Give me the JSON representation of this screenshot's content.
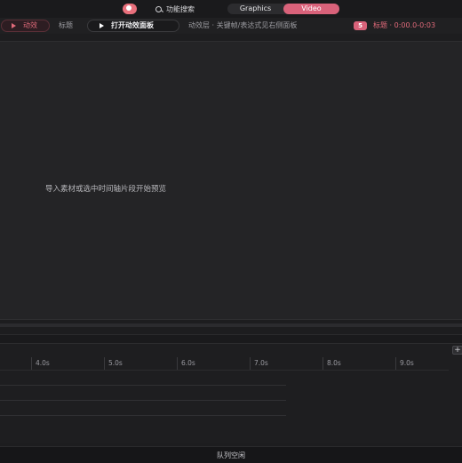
{
  "topbar": {
    "search_label": "功能搜索",
    "mode_tabs": [
      {
        "label": "Graphics",
        "active": false
      },
      {
        "label": "Video",
        "active": true
      }
    ]
  },
  "toolbar": {
    "effect_label": "动效",
    "title_label": "标题",
    "open_panel_label": "打开动效面板",
    "hint_text": "动效层 · 关键帧/表达式见右侧面板",
    "badge_count": "5",
    "time_range": "标题 · 0:00.0-0:03"
  },
  "preview": {
    "empty_hint": "导入素材或选中时间轴片段开始预览"
  },
  "timeline": {
    "add_track_label": "+",
    "ticks": [
      "4.0s",
      "5.0s",
      "6.0s",
      "7.0s",
      "8.0s",
      "9.0s"
    ]
  },
  "status": {
    "text": "队列空闲"
  },
  "colors": {
    "accent": "#d9627a",
    "background": "#1d1d1f"
  }
}
